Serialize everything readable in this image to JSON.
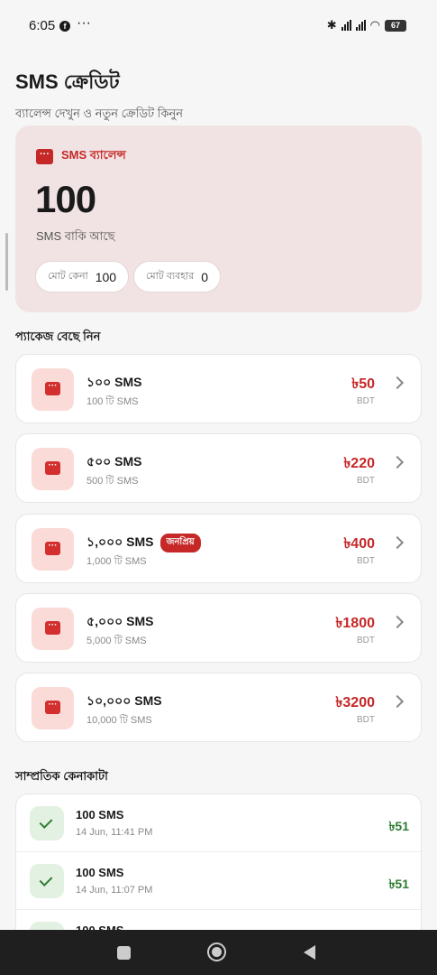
{
  "status": {
    "time": "6:05",
    "battery": "67"
  },
  "header": {
    "title": "SMS ক্রেডিট",
    "subtitle": "ব্যালেন্স দেখুন ও নতুন ক্রেডিট কিনুন"
  },
  "balance": {
    "label": "SMS ব্যালেন্স",
    "value": "100",
    "remaining_text": "SMS বাকি আছে",
    "total_bought_label": "মোট কেনা",
    "total_bought_value": "100",
    "total_used_label": "মোট ব্যবহার",
    "total_used_value": "0"
  },
  "packages_title": "প্যাকেজ বেছে নিন",
  "packages": [
    {
      "name": "১০০ SMS",
      "sub": "100 টি SMS",
      "price": "৳50",
      "currency": "BDT",
      "badge": ""
    },
    {
      "name": "৫০০ SMS",
      "sub": "500 টি SMS",
      "price": "৳220",
      "currency": "BDT",
      "badge": ""
    },
    {
      "name": "১,০০০ SMS",
      "sub": "1,000 টি SMS",
      "price": "৳400",
      "currency": "BDT",
      "badge": "জনপ্রিয়"
    },
    {
      "name": "৫,০০০ SMS",
      "sub": "5,000 টি SMS",
      "price": "৳1800",
      "currency": "BDT",
      "badge": ""
    },
    {
      "name": "১০,০০০ SMS",
      "sub": "10,000 টি SMS",
      "price": "৳3200",
      "currency": "BDT",
      "badge": ""
    }
  ],
  "recent_title": "সাম্প্রতিক কেনাকাটা",
  "recent": [
    {
      "title": "100 SMS",
      "date": "14 Jun, 11:41 PM",
      "amount": "৳51"
    },
    {
      "title": "100 SMS",
      "date": "14 Jun, 11:07 PM",
      "amount": "৳51"
    },
    {
      "title": "100 SMS",
      "date": "",
      "amount": ""
    }
  ],
  "colors": {
    "accent": "#c62828",
    "success": "#2e7d32",
    "card_bg": "#f1e3e3"
  }
}
